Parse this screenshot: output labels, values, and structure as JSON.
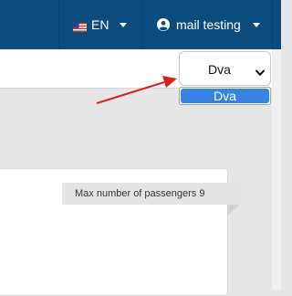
{
  "header": {
    "language": {
      "label": "EN",
      "flag_icon": "us-flag-icon"
    },
    "user": {
      "label": "mail testing",
      "icon": "user-circle-icon"
    }
  },
  "select": {
    "value": "Dva",
    "options": [
      "Dva"
    ],
    "highlighted_option": "Dva"
  },
  "tooltip": {
    "text": "Max number of passengers 9"
  },
  "colors": {
    "header_bg": "#0b4b7e",
    "option_highlight": "#3584e4",
    "arrow": "#e11d1d"
  }
}
